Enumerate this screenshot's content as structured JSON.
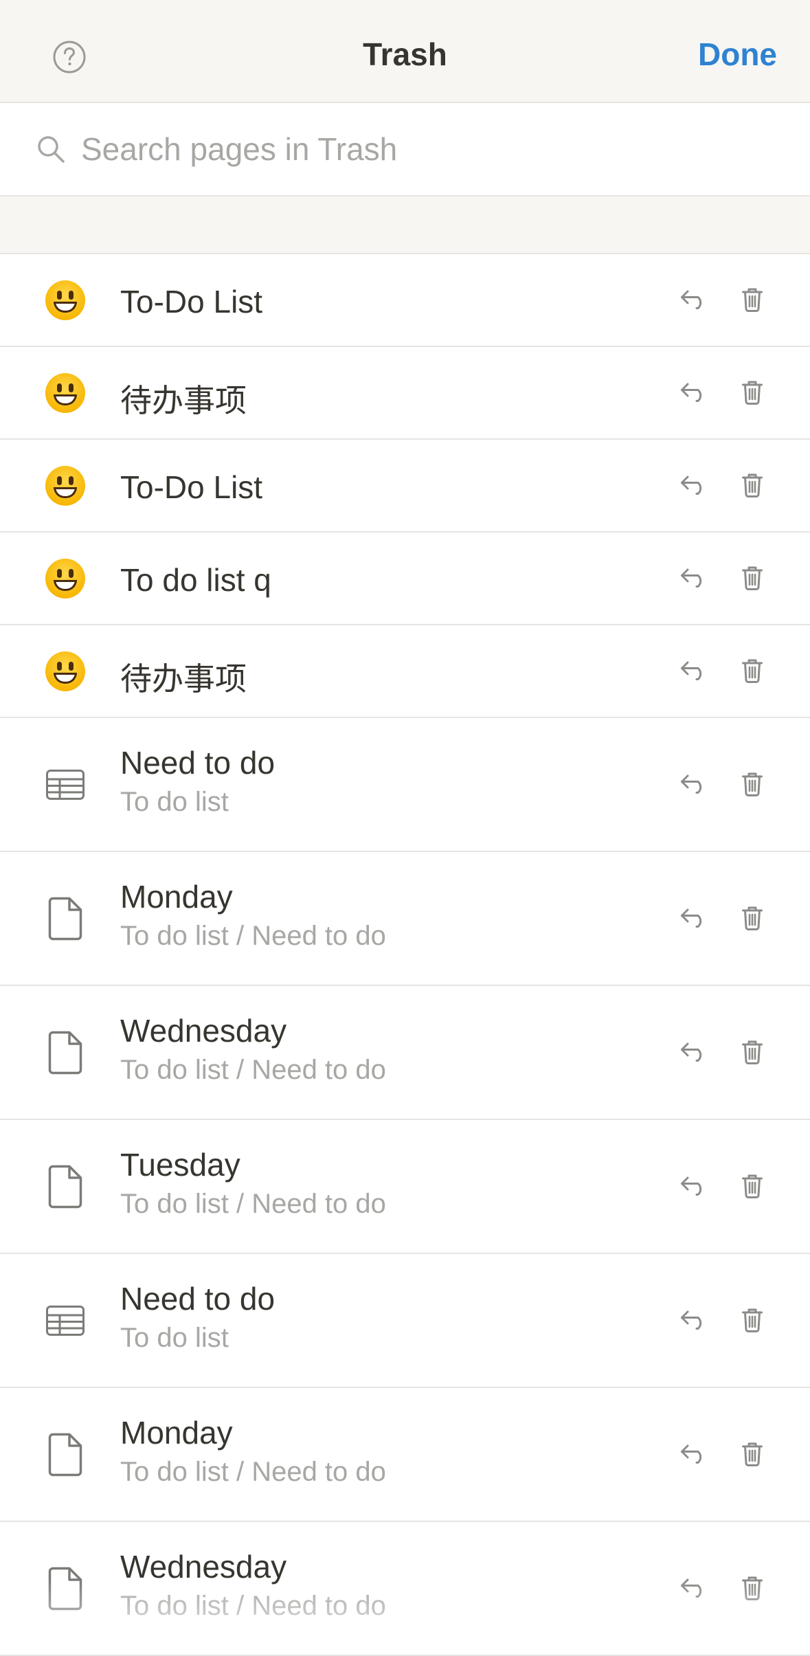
{
  "header": {
    "title": "Trash",
    "done_label": "Done",
    "help_icon": "help-circle-icon"
  },
  "search": {
    "placeholder": "Search pages in Trash",
    "value": ""
  },
  "colors": {
    "accent": "#2e82d1",
    "header_bg": "#f7f6f3",
    "text": "#37352f",
    "secondary_text": "#a8a7a4",
    "divider": "#e6e5e2"
  },
  "items": [
    {
      "icon": "smiley-emoji-icon",
      "title": "To-Do List",
      "subtitle": ""
    },
    {
      "icon": "smiley-emoji-icon",
      "title": "待办事项",
      "subtitle": ""
    },
    {
      "icon": "smiley-emoji-icon",
      "title": "To-Do List",
      "subtitle": ""
    },
    {
      "icon": "smiley-emoji-icon",
      "title": "To do list q",
      "subtitle": ""
    },
    {
      "icon": "smiley-emoji-icon",
      "title": "待办事项",
      "subtitle": ""
    },
    {
      "icon": "table-icon",
      "title": "Need to do",
      "subtitle": "To do list"
    },
    {
      "icon": "page-icon",
      "title": "Monday",
      "subtitle": "To do list / Need to do"
    },
    {
      "icon": "page-icon",
      "title": "Wednesday",
      "subtitle": "To do list / Need to do"
    },
    {
      "icon": "page-icon",
      "title": "Tuesday",
      "subtitle": "To do list / Need to do"
    },
    {
      "icon": "table-icon",
      "title": "Need to do",
      "subtitle": "To do list"
    },
    {
      "icon": "page-icon",
      "title": "Monday",
      "subtitle": "To do list / Need to do"
    },
    {
      "icon": "page-icon",
      "title": "Wednesday",
      "subtitle": "To do list / Need to do"
    }
  ],
  "row_actions": {
    "restore_icon": "restore-arrow-icon",
    "delete_icon": "trash-icon"
  }
}
